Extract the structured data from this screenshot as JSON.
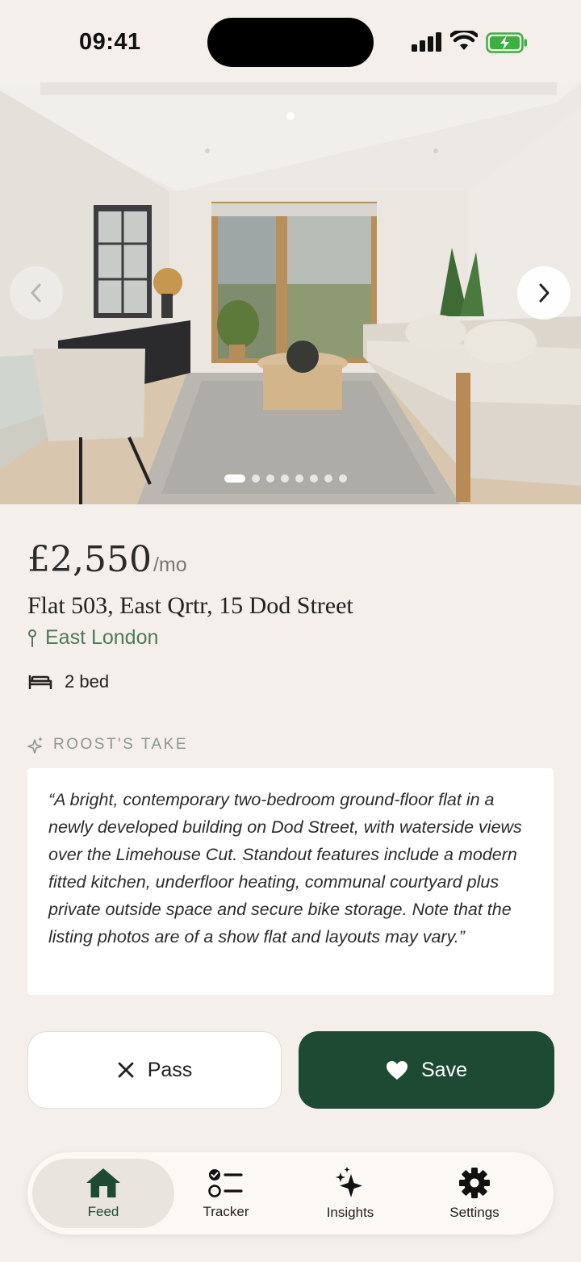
{
  "status_bar": {
    "time": "09:41",
    "icons": [
      "cellular-signal-icon",
      "wifi-icon",
      "battery-charging-icon"
    ],
    "battery_color": "#3cb043"
  },
  "gallery": {
    "photo_alt": "Living room with sofa, rug and window",
    "image_count": 8,
    "active_index": 1,
    "prev_icon": "chevron-left-icon",
    "next_icon": "chevron-right-icon"
  },
  "listing": {
    "price": "£2,550",
    "price_unit": "/mo",
    "address": "Flat 503, East Qrtr, 15 Dod Street",
    "location_icon": "pin-icon",
    "location": "East London",
    "beds_icon": "bed-icon",
    "beds": "2 bed"
  },
  "take": {
    "icon": "sparkle-icon",
    "label": "ROOST'S TAKE",
    "text": "“A bright, contemporary two-bedroom ground-floor flat in a newly developed building on Dod Street, with waterside views over the Limehouse Cut. Standout features include a modern fitted kitchen, underfloor heating, communal courtyard plus private outside space and secure bike storage. Note that the listing photos are of a show flat and layouts may vary.”"
  },
  "actions": {
    "pass_label": "Pass",
    "pass_icon": "close-icon",
    "save_label": "Save",
    "save_icon": "heart-icon"
  },
  "tabs": [
    {
      "label": "Feed",
      "icon": "home-icon",
      "active": true
    },
    {
      "label": "Tracker",
      "icon": "checklist-icon",
      "active": false
    },
    {
      "label": "Insights",
      "icon": "sparkles-icon",
      "active": false
    },
    {
      "label": "Settings",
      "icon": "gear-icon",
      "active": false
    }
  ],
  "colors": {
    "background": "#f4efea",
    "accent": "#1e4a33",
    "location_green": "#4f7a5a"
  }
}
